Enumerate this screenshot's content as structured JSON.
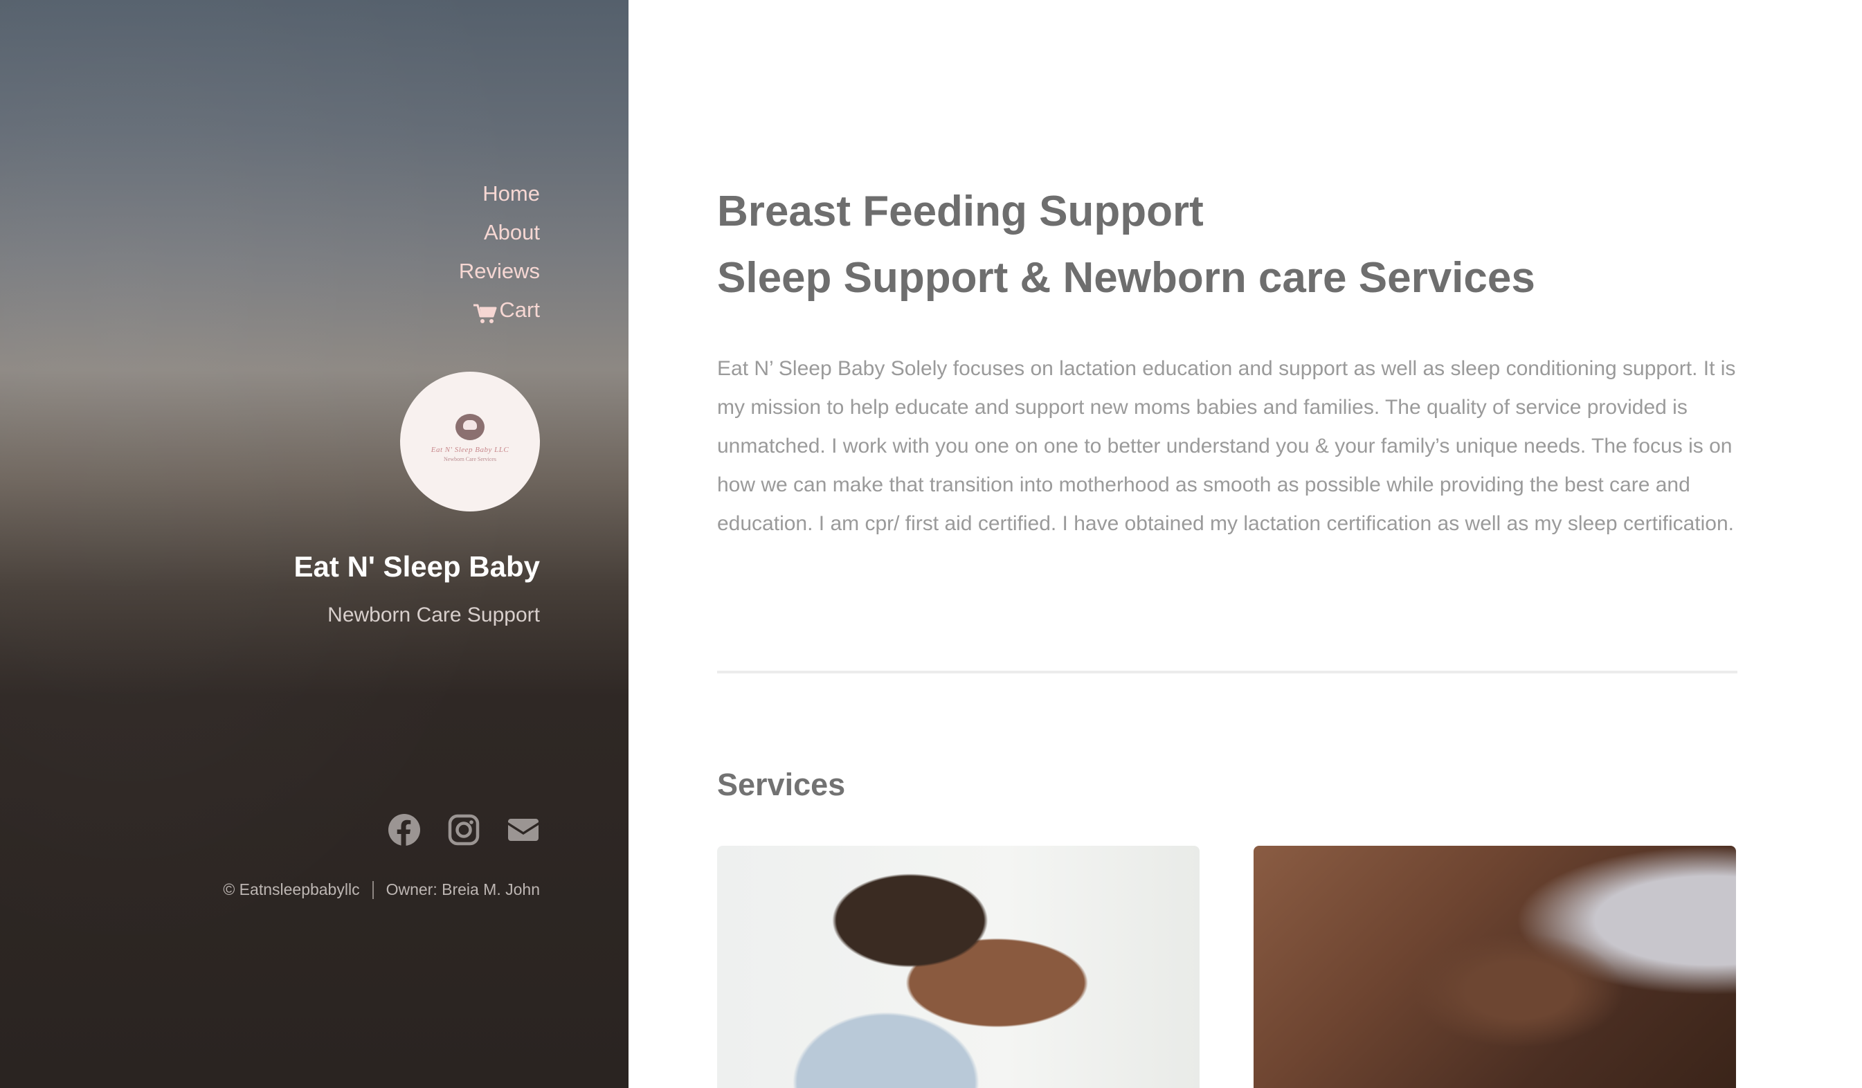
{
  "nav": {
    "items": [
      {
        "label": "Home"
      },
      {
        "label": "About"
      },
      {
        "label": "Reviews"
      },
      {
        "label": "Cart",
        "icon": "cart-icon"
      }
    ]
  },
  "logo": {
    "line1": "Eat N' Sleep Baby LLC",
    "line2": "Newborn Care Services"
  },
  "site": {
    "title": "Eat N' Sleep Baby",
    "subtitle": "Newborn Care Support"
  },
  "social": [
    "facebook-icon",
    "instagram-icon",
    "email-icon"
  ],
  "footer": {
    "copyright": "© Eatnsleepbabyllc",
    "owner": "Owner: Breia M. John"
  },
  "main": {
    "headline_line1": "Breast Feeding Support",
    "headline_line2": "Sleep Support & Newborn care Services",
    "intro": "Eat N’ Sleep Baby Solely focuses on lactation education and support as well as sleep conditioning support. It is my mission to help educate and support new moms babies and families. The quality of service provided is unmatched. I work with you one on one to better understand you & your family’s unique needs. The focus is on how we can make that transition into motherhood as smooth as possible while providing the best care and education. I am cpr/ first aid certified. I have obtained my lactation certification as well as my sleep certification.",
    "services_title": "Services"
  },
  "colors": {
    "nav_link": "#f6d7d3",
    "heading": "#6e6e6e",
    "body_text": "#9a9a9a"
  }
}
